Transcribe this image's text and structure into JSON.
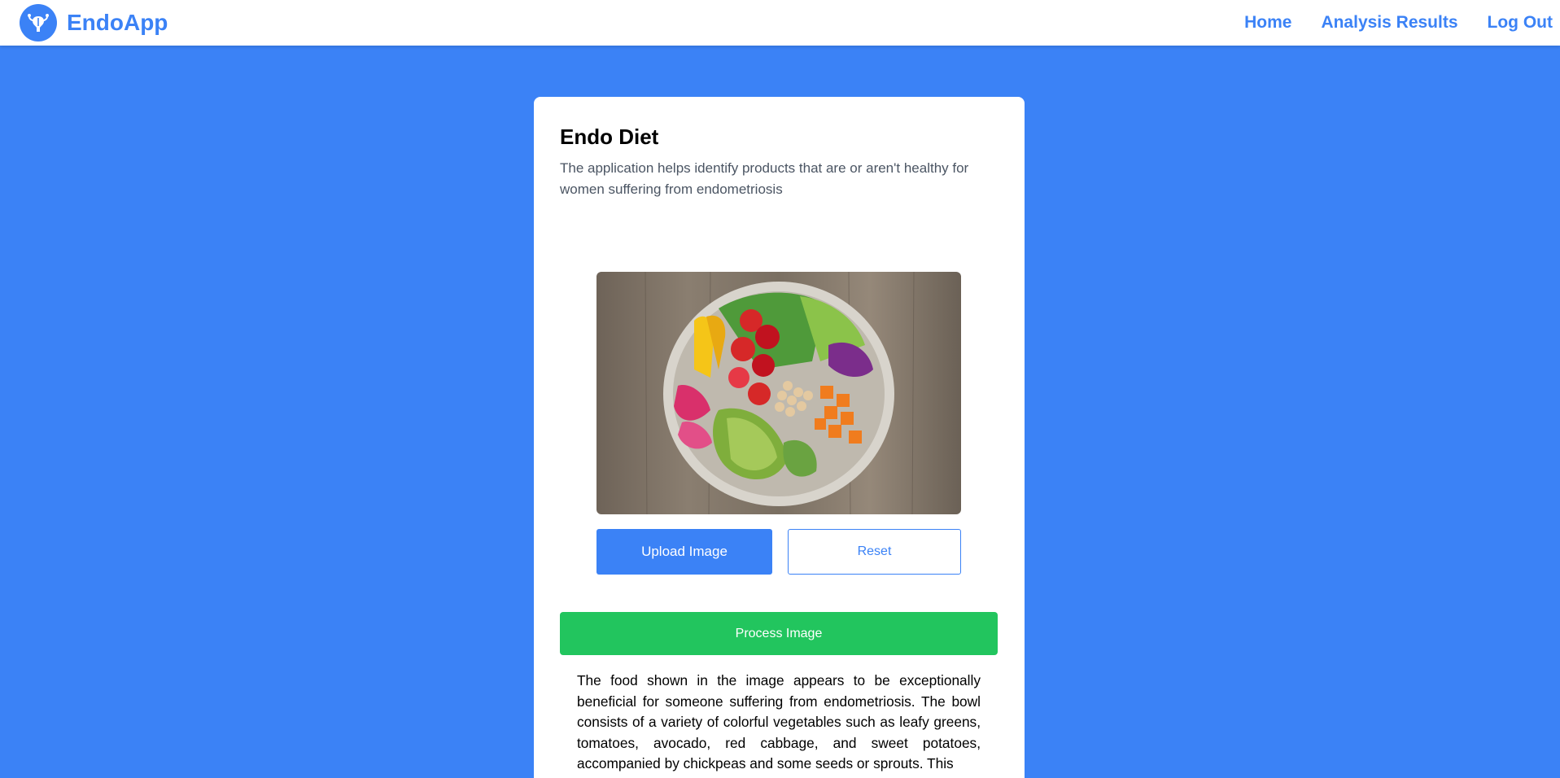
{
  "navbar": {
    "brand_name": "EndoApp",
    "brand_icon": "uterus-icon",
    "links": [
      {
        "label": "Home"
      },
      {
        "label": "Analysis Results"
      },
      {
        "label": "Log Out"
      }
    ]
  },
  "card": {
    "title": "Endo Diet",
    "description": "The application helps identify products that are or aren't healthy for women suffering from endometriosis",
    "buttons": {
      "upload_label": "Upload Image",
      "reset_label": "Reset",
      "process_label": "Process Image"
    },
    "result_text": "The food shown in the image appears to be exceptionally beneficial for someone suffering from endometriosis. The bowl consists of a variety of colorful vegetables such as leafy greens, tomatoes, avocado, red cabbage, and sweet potatoes, accompanied by chickpeas and some seeds or sprouts. This"
  },
  "colors": {
    "primary": "#3b82f6",
    "process_button": "#22c55e",
    "background": "#3b82f6"
  }
}
